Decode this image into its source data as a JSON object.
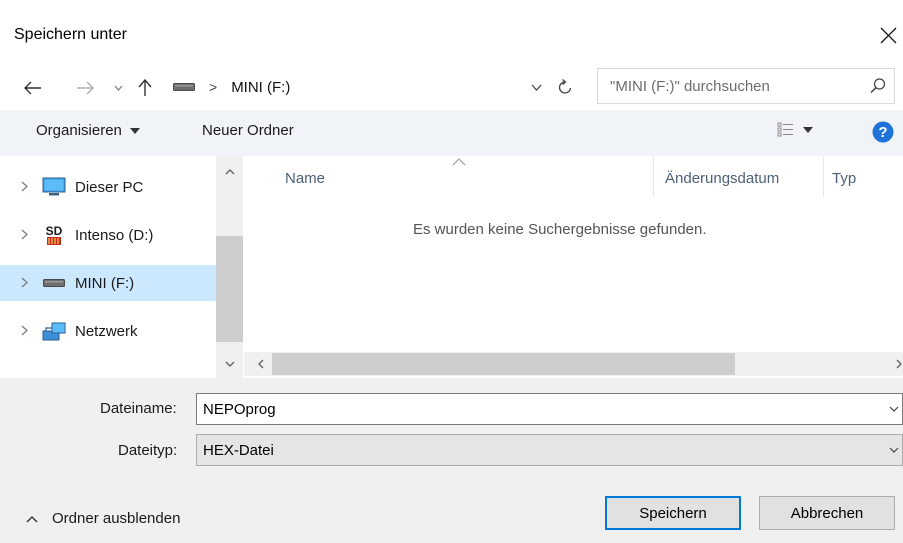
{
  "window": {
    "title": "Speichern unter"
  },
  "address": {
    "path_label": "MINI (F:)",
    "separator": ">"
  },
  "search": {
    "placeholder": "\"MINI (F:)\" durchsuchen"
  },
  "toolbar": {
    "organize_label": "Organisieren",
    "new_folder_label": "Neuer Ordner"
  },
  "nav": {
    "items": [
      {
        "label": "Dieser PC",
        "icon": "computer-icon",
        "selected": false
      },
      {
        "label": "Intenso (D:)",
        "icon": "sd-card-icon",
        "selected": false
      },
      {
        "label": "MINI (F:)",
        "icon": "drive-icon",
        "selected": true
      },
      {
        "label": "Netzwerk",
        "icon": "network-icon",
        "selected": false
      }
    ]
  },
  "file_list": {
    "columns": [
      "Name",
      "Änderungsdatum",
      "Typ"
    ],
    "empty_message": "Es wurden keine Suchergebnisse gefunden."
  },
  "form": {
    "filename_label": "Dateiname:",
    "filename_value": "NEPOprog",
    "filetype_label": "Dateityp:",
    "filetype_value": "HEX-Datei"
  },
  "footer": {
    "hide_folders_label": "Ordner ausblenden",
    "save_label": "Speichern",
    "cancel_label": "Abbrechen"
  },
  "colors": {
    "toolbar_bg": "#f0f4f9",
    "selected_bg": "#cce8ff",
    "accent": "#0078d7",
    "column_header": "#4c607a",
    "help": "#1e73d8"
  }
}
